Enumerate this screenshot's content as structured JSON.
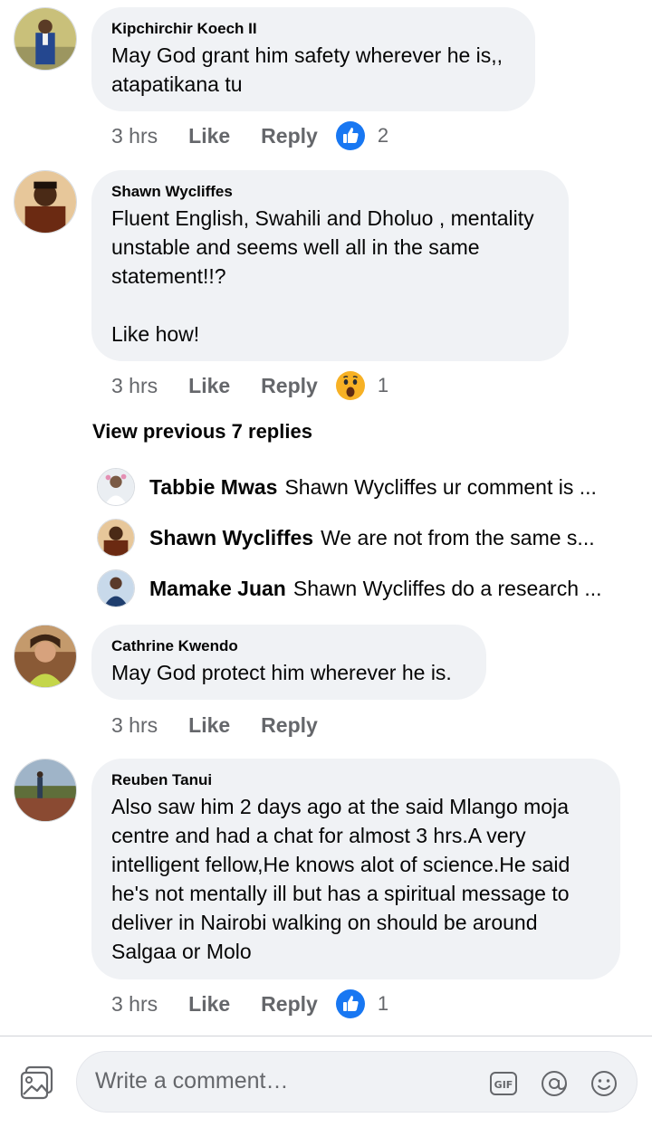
{
  "colors": {
    "accent": "#1877f2",
    "bubble": "#f0f2f5",
    "secondary_text": "#65676b"
  },
  "comments": [
    {
      "author": "Kipchirchir Koech II",
      "text": "May God grant him safety wherever he is,,\natapatikana tu",
      "time": "3 hrs",
      "like_label": "Like",
      "reply_label": "Reply",
      "reaction": {
        "icon": "thumbs-up-icon",
        "count": "2"
      }
    },
    {
      "author": "Shawn Wycliffes",
      "text": "Fluent English, Swahili and Dholuo , mentality\nunstable and seems well all in the same\nstatement!!?\n\nLike how!",
      "time": "3 hrs",
      "like_label": "Like",
      "reply_label": "Reply",
      "reaction": {
        "icon": "wow-icon",
        "count": "1"
      }
    },
    {
      "author": "Cathrine Kwendo",
      "text": "May God protect him wherever he is.",
      "time": "3 hrs",
      "like_label": "Like",
      "reply_label": "Reply"
    },
    {
      "author": "Reuben Tanui",
      "text": "Also saw him 2 days ago at the said Mlango moja\ncentre and had a chat for almost 3 hrs.A very\nintelligent fellow,He knows alot of science.He said\nhe's not mentally ill but has a spiritual message to\ndeliver in Nairobi walking on should be around\nSalgaa or Molo",
      "time": "3 hrs",
      "like_label": "Like",
      "reply_label": "Reply",
      "reaction": {
        "icon": "thumbs-up-icon",
        "count": "1"
      }
    }
  ],
  "view_previous": "View previous 7 replies",
  "replies": [
    {
      "name": "Tabbie Mwas",
      "text": "Shawn Wycliffes ur comment is ..."
    },
    {
      "name": "Shawn Wycliffes",
      "text": "We are not from the same s..."
    },
    {
      "name": "Mamake Juan",
      "text": "Shawn Wycliffes do a research ..."
    }
  ],
  "composer": {
    "placeholder": "Write a comment…",
    "icons": [
      "photo-icon",
      "gif-icon",
      "mention-icon",
      "emoji-icon"
    ]
  }
}
